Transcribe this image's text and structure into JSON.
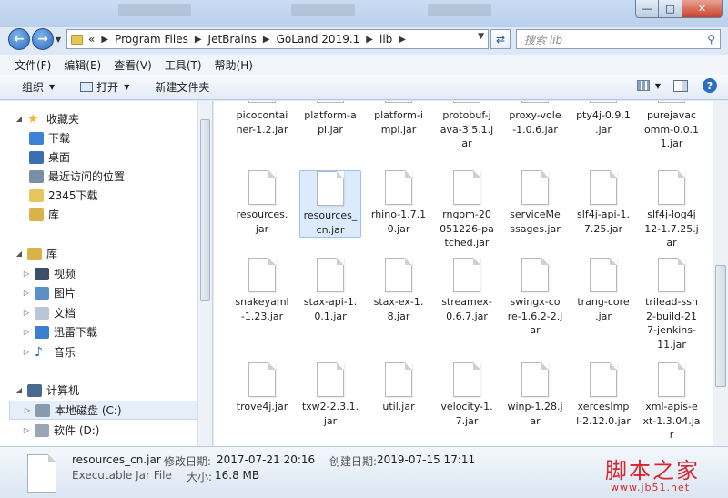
{
  "window": {
    "min_glyph": "—",
    "max_glyph": "□",
    "close_glyph": "✕"
  },
  "address": {
    "overflow": "«",
    "crumbs": [
      "Program Files",
      "JetBrains",
      "GoLand 2019.1",
      "lib"
    ],
    "search_placeholder": "搜索 lib"
  },
  "menu": [
    "文件(F)",
    "编辑(E)",
    "查看(V)",
    "工具(T)",
    "帮助(H)"
  ],
  "toolbar": {
    "organize": "组织",
    "open": "打开",
    "new_folder": "新建文件夹"
  },
  "nav": [
    {
      "label": "收藏夹",
      "icon": "star-icon",
      "color": "#f2b632"
    },
    {
      "label": "下载",
      "icon": "downloads-folder-icon",
      "color": "#3c83d6"
    },
    {
      "label": "桌面",
      "icon": "desktop-icon",
      "color": "#3a6fb0"
    },
    {
      "label": "最近访问的位置",
      "icon": "recent-places-icon",
      "color": "#7a8ea8"
    },
    {
      "label": "2345下载",
      "icon": "folder-icon",
      "color": "#e7c75b"
    },
    {
      "label": "库",
      "icon": "library-icon",
      "color": "#d9b24a"
    },
    {
      "label": "库",
      "icon": "library-icon",
      "color": "#d9b24a"
    },
    {
      "label": "视频",
      "icon": "video-icon",
      "color": "#3c4f6a"
    },
    {
      "label": "图片",
      "icon": "pictures-icon",
      "color": "#5a8fc8"
    },
    {
      "label": "文档",
      "icon": "documents-icon",
      "color": "#b8c6d8"
    },
    {
      "label": "迅雷下载",
      "icon": "thunder-download-icon",
      "color": "#3a7fd0"
    },
    {
      "label": "音乐",
      "icon": "music-icon",
      "color": "#2d6cc0"
    },
    {
      "label": "计算机",
      "icon": "computer-icon",
      "color": "#4a6a90"
    },
    {
      "label": "本地磁盘 (C:)",
      "icon": "drive-c-icon",
      "color": "#8a9aae"
    },
    {
      "label": "软件 (D:)",
      "icon": "drive-d-icon",
      "color": "#9aa6b6"
    }
  ],
  "files": [
    "picocontainer-1.2.jar",
    "platform-api.jar",
    "platform-impl.jar",
    "protobuf-java-3.5.1.jar",
    "proxy-vole-1.0.6.jar",
    "pty4j-0.9.1.jar",
    "purejavacomm-0.0.11.jar",
    "resources.jar",
    "resources_cn.jar",
    "rhino-1.7.10.jar",
    "rngom-20051226-patched.jar",
    "serviceMessages.jar",
    "slf4j-api-1.7.25.jar",
    "slf4j-log4j12-1.7.25.jar",
    "snakeyaml-1.23.jar",
    "stax-api-1.0.1.jar",
    "stax-ex-1.8.jar",
    "streamex-0.6.7.jar",
    "swingx-core-1.6.2-2.jar",
    "trang-core.jar",
    "trilead-ssh2-build-217-jenkins-11.jar",
    "trove4j.jar",
    "txw2-2.3.1.jar",
    "util.jar",
    "velocity-1.7.jar",
    "winp-1.28.jar",
    "xercesImpl-2.12.0.jar",
    "xml-apis-ext-1.3.04.jar"
  ],
  "files_display": [
    "picocontai\nner-1.2.jar",
    "platform-a\npi.jar",
    "platform-i\nmpl.jar",
    "protobuf-j\nava-3.5.1.j\nar",
    "proxy-vole\n-1.0.6.jar",
    "pty4j-0.9.1\n.jar",
    "purejavac\nomm-0.0.1\n1.jar",
    "resources.\njar",
    "resources_\ncn.jar",
    "rhino-1.7.1\n0.jar",
    "rngom-20\n051226-pa\ntched.jar",
    "serviceMe\nssages.jar",
    "slf4j-api-1.\n7.25.jar",
    "slf4j-log4j\n12-1.7.25.j\nar",
    "snakeyaml\n-1.23.jar",
    "stax-api-1.\n0.1.jar",
    "stax-ex-1.\n8.jar",
    "streamex-\n0.6.7.jar",
    "swingx-co\nre-1.6.2-2.j\nar",
    "trang-core\n.jar",
    "trilead-ssh\n2-build-21\n7-jenkins-\n11.jar",
    "trove4j.jar",
    "txw2-2.3.1.\njar",
    "util.jar",
    "velocity-1.\n7.jar",
    "winp-1.28.j\nar",
    "xercesImp\nl-2.12.0.jar",
    "xml-apis-e\nxt-1.3.04.ja\nr"
  ],
  "selected_file": "resources_cn.jar",
  "details": {
    "name": "resources_cn.jar",
    "type": "Executable Jar File",
    "modified_label": "修改日期:",
    "modified_value": "2017-07-21 20:16",
    "created_label": "创建日期:",
    "created_value": "2019-07-15 17:11",
    "size_label": "大小:",
    "size_value": "16.8 MB"
  },
  "watermark": {
    "text": "脚本之家",
    "url": "www.jb51.net"
  }
}
